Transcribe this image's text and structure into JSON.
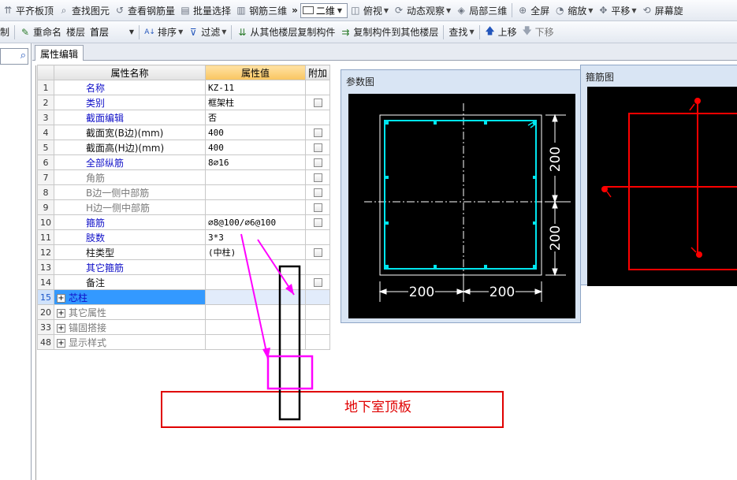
{
  "toolbar1": {
    "items": [
      {
        "label": "平齐板顶",
        "icon": "align-slab-icon"
      },
      {
        "label": "查找图元",
        "icon": "binoculars-icon"
      },
      {
        "label": "查看钢筋量",
        "icon": "rebar-view-icon"
      },
      {
        "label": "批量选择",
        "icon": "batch-select-icon"
      },
      {
        "label": "钢筋三维",
        "icon": "rebar-3d-icon"
      }
    ],
    "overflow": "»",
    "view_mode": "二维",
    "view_items": [
      {
        "label": "俯视",
        "icon": "top-view-icon"
      },
      {
        "label": "动态观察",
        "icon": "orbit-icon"
      },
      {
        "label": "局部三维",
        "icon": "local-3d-icon"
      },
      {
        "label": "全屏",
        "icon": "fullscreen-icon"
      },
      {
        "label": "缩放",
        "icon": "zoom-icon"
      },
      {
        "label": "平移",
        "icon": "pan-icon"
      },
      {
        "label": "屏幕旋",
        "icon": "rotate-screen-icon"
      }
    ]
  },
  "toolbar2": {
    "copy_fragment": "制",
    "rename": "重命名",
    "floor_label": "楼层",
    "floor_value": "首层",
    "sort": "排序",
    "filter": "过滤",
    "copy_from": "从其他楼层复制构件",
    "copy_to": "复制构件到其他楼层",
    "find": "查找",
    "move_up": "上移",
    "move_down": "下移"
  },
  "tab": {
    "label": "属性编辑"
  },
  "grid": {
    "headers": {
      "name": "属性名称",
      "value": "属性值",
      "extra": "附加"
    },
    "rows": [
      {
        "no": "1",
        "name": "名称",
        "value": "KZ-11",
        "color": "blue",
        "check": false
      },
      {
        "no": "2",
        "name": "类别",
        "value": "框架柱",
        "color": "blue",
        "check": true
      },
      {
        "no": "3",
        "name": "截面编辑",
        "value": "否",
        "color": "blue",
        "check": false
      },
      {
        "no": "4",
        "name": "截面宽(B边)(mm)",
        "value": "400",
        "color": "black",
        "check": true
      },
      {
        "no": "5",
        "name": "截面高(H边)(mm)",
        "value": "400",
        "color": "black",
        "check": true
      },
      {
        "no": "6",
        "name": "全部纵筋",
        "value": "8⌀16",
        "color": "blue",
        "check": true
      },
      {
        "no": "7",
        "name": "角筋",
        "value": "",
        "color": "gray",
        "check": true
      },
      {
        "no": "8",
        "name": "B边一侧中部筋",
        "value": "",
        "color": "gray",
        "check": true
      },
      {
        "no": "9",
        "name": "H边一侧中部筋",
        "value": "",
        "color": "gray",
        "check": true
      },
      {
        "no": "10",
        "name": "箍筋",
        "value": "⌀8@100/⌀6@100",
        "color": "blue",
        "check": true
      },
      {
        "no": "11",
        "name": "肢数",
        "value": "3*3",
        "color": "blue",
        "check": false
      },
      {
        "no": "12",
        "name": "柱类型",
        "value": "(中柱)",
        "color": "black",
        "check": true
      },
      {
        "no": "13",
        "name": "其它箍筋",
        "value": "",
        "color": "blue",
        "check": false
      },
      {
        "no": "14",
        "name": "备注",
        "value": "",
        "color": "black",
        "check": true
      },
      {
        "no": "15",
        "name": "芯柱",
        "value": "",
        "color": "blue",
        "group": true,
        "selected": true
      },
      {
        "no": "20",
        "name": "其它属性",
        "value": "",
        "color": "gray",
        "group": true
      },
      {
        "no": "33",
        "name": "锚固搭接",
        "value": "",
        "color": "gray",
        "group": true
      },
      {
        "no": "48",
        "name": "显示样式",
        "value": "",
        "color": "gray",
        "group": true
      }
    ]
  },
  "param_panel": {
    "title": "参数图",
    "dim_bottom_left": "200",
    "dim_bottom_right": "200",
    "dim_right_top": "200",
    "dim_right_bottom": "200"
  },
  "stirrup_panel": {
    "title": "箍筋图"
  },
  "annotation": {
    "label": "地下室顶板"
  },
  "colors": {
    "annotation_red": "#e00000",
    "arrow_magenta": "#ff00ff",
    "rebar_cyan": "#00e5ee",
    "stirrup_red": "#ff0000"
  }
}
